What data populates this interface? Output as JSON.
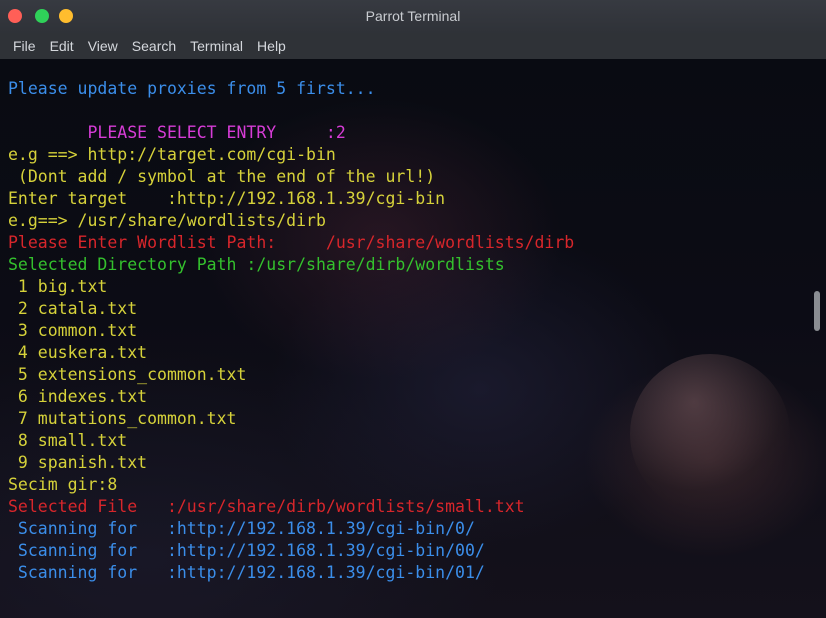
{
  "window": {
    "title": "Parrot Terminal"
  },
  "menu": [
    "File",
    "Edit",
    "View",
    "Search",
    "Terminal",
    "Help"
  ],
  "terminal": {
    "lines": [
      {
        "text": "Please update proxies from 5 first...",
        "color": "blue"
      },
      {
        "text": "",
        "color": ""
      },
      {
        "text": "        PLEASE SELECT ENTRY     :2",
        "color": "magenta"
      },
      {
        "text": "e.g ==> http://target.com/cgi-bin",
        "color": "yellow"
      },
      {
        "text": " (Dont add / symbol at the end of the url!)",
        "color": "yellow"
      },
      {
        "text": "Enter target    :http://192.168.1.39/cgi-bin",
        "color": "yellow"
      },
      {
        "text": "e.g==> /usr/share/wordlists/dirb",
        "color": "yellow"
      },
      {
        "text": "Please Enter Wordlist Path:     /usr/share/wordlists/dirb",
        "color": "red"
      },
      {
        "text": "Selected Directory Path :/usr/share/dirb/wordlists",
        "color": "green"
      },
      {
        "text": " 1 big.txt",
        "color": "yellow"
      },
      {
        "text": " 2 catala.txt",
        "color": "yellow"
      },
      {
        "text": " 3 common.txt",
        "color": "yellow"
      },
      {
        "text": " 4 euskera.txt",
        "color": "yellow"
      },
      {
        "text": " 5 extensions_common.txt",
        "color": "yellow"
      },
      {
        "text": " 6 indexes.txt",
        "color": "yellow"
      },
      {
        "text": " 7 mutations_common.txt",
        "color": "yellow"
      },
      {
        "text": " 8 small.txt",
        "color": "yellow"
      },
      {
        "text": " 9 spanish.txt",
        "color": "yellow"
      },
      {
        "text": "Secim gir:8",
        "color": "yellow"
      },
      {
        "text": "Selected File   :/usr/share/dirb/wordlists/small.txt",
        "color": "red"
      },
      {
        "text": " Scanning for   :http://192.168.1.39/cgi-bin/0/",
        "color": "blue"
      },
      {
        "text": " Scanning for   :http://192.168.1.39/cgi-bin/00/",
        "color": "blue"
      },
      {
        "text": " Scanning for   :http://192.168.1.39/cgi-bin/01/",
        "color": "blue"
      }
    ]
  },
  "colors": {
    "blue": "#3b8eea",
    "magenta": "#d73cd7",
    "yellow": "#d6d23a",
    "red": "#d7262b",
    "green": "#34c12d"
  },
  "icons": {
    "close": "close-icon",
    "minimize": "minimize-icon",
    "maximize": "maximize-icon"
  }
}
